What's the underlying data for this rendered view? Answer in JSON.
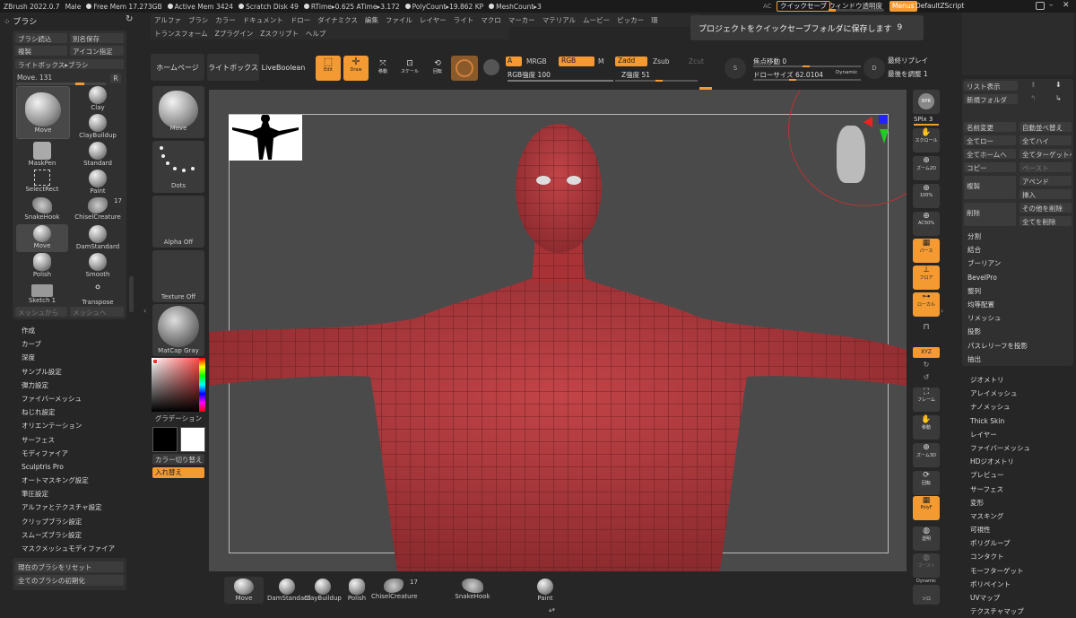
{
  "titlebar": {
    "app": "ZBrush 2022.0.7",
    "doc": "Male",
    "free_mem": "Free Mem 17.273GB",
    "active_mem": "Active Mem 3424",
    "scratch": "Scratch Disk 49",
    "rtime": "RTime▸0.625 ATime▸3.172",
    "polycount": "PolyCount▸19.862 KP",
    "meshcount": "MeshCount▸3",
    "ac": "AC",
    "quicksave": "クイックセーブ",
    "transparency": "ウィンドウ透明度",
    "menus": "Menus",
    "script": "DefaultZScript"
  },
  "menubar": {
    "row1": [
      "アルファ",
      "ブラシ",
      "カラー",
      "ドキュメント",
      "ドロー",
      "ダイナミクス",
      "編集",
      "ファイル",
      "レイヤー",
      "ライト",
      "マクロ",
      "マーカー",
      "マテリアル",
      "ムービー",
      "ピッカー",
      "環"
    ],
    "row2": [
      "トランスフォーム",
      "Zプラグイン",
      "Zスクリプト",
      "ヘルプ"
    ]
  },
  "notification": {
    "text": "プロジェクトをクイックセーブフォルダに保存します",
    "count": "9"
  },
  "brush_panel": {
    "title": "ブラシ",
    "load": "ブラシ読込",
    "save_as": "別名保存",
    "copy": "複製",
    "icon_set": "アイコン指定",
    "lightbox": "ライトボックス▸ブラシ",
    "current": "Move. 131",
    "r": "R",
    "brushes": [
      "Move",
      "Clay",
      "ClayBuildup",
      "MaskPen",
      "Standard",
      "SelectRect",
      "Paint",
      "SnakeHook",
      "ChiselCreature",
      "Move",
      "DamStandard",
      "Polish",
      "Smooth",
      "Sketch 1",
      "Transpose"
    ],
    "chisel_count": "17",
    "from_mesh": "メッシュから",
    "to_mesh": "メッシュへ",
    "menu": [
      "作成",
      "カーブ",
      "深度",
      "サンプル設定",
      "弾力設定",
      "ファイバーメッシュ",
      "ねじれ設定",
      "オリエンテーション",
      "サーフェス",
      "モディファイア",
      "Sculptris Pro",
      "オートマスキング設定",
      "筆圧設定",
      "アルファとテクスチャ設定",
      "クリップブラシ設定",
      "スムーズブラシ設定",
      "マスクメッシュモディファイア"
    ],
    "reset": "現在のブラシをリセット",
    "init_all": "全てのブラシの初期化"
  },
  "tray": {
    "move": "Move",
    "dots": "Dots",
    "alpha": "Alpha Off",
    "texture": "Texture Off",
    "matcap": "MatCap Gray",
    "gradient": "グラデーション",
    "swap_color": "カラー切り替え",
    "swap": "入れ替え"
  },
  "top_shelf": {
    "home": "ホームページ",
    "lightbox": "ライトボックス",
    "liveboolean": "LiveBoolean",
    "edit": "Edit",
    "draw": "Draw",
    "move": "移動",
    "scale": "スケール",
    "rotate": "回転",
    "a": "A",
    "mrgb": "MRGB",
    "rgb": "RGB",
    "m": "M",
    "rgb_strength": "RGB強度 100",
    "zadd": "Zadd",
    "zsub": "Zsub",
    "zcut": "Zcut",
    "z_strength": "Z強度 51",
    "focal_shift": "焦点移動 0",
    "draw_size": "ドローサイズ 62.0104",
    "dynamic": "Dynamic",
    "replay_last": "最終リプレイ",
    "adjust_last": "最後を調整 1"
  },
  "right_tools": {
    "bpr": "BPR",
    "spix": "SPix 3",
    "scroll": "スクロール",
    "zoom2d": "ズーム2D",
    "pct100": "100%",
    "ac50": "AC50%",
    "perspective": "パース",
    "floor": "フロア",
    "local": "ローカル",
    "xyz": "XYZ",
    "frame": "フレーム",
    "move": "移動",
    "zoom3d": "ズーム3D",
    "rotate": "回転",
    "polyf": "PolyF",
    "transp": "透明",
    "ghost": "ゴースト",
    "dynamic": "Dynamic",
    "solo": "ソロ"
  },
  "subtool": {
    "list_view": "リスト表示",
    "new_folder": "新規フォルダ",
    "rename": "名前変更",
    "auto_sort": "自動並べ替え",
    "all_low": "全てロー",
    "all_high": "全てハイ",
    "all_home": "全てホームへ",
    "all_target": "全てターゲットへ",
    "copy": "コピー",
    "paste": "ペースト",
    "duplicate": "複製",
    "append": "アペンド",
    "insert": "挿入",
    "delete": "削除",
    "del_other": "その他を削除",
    "del_all": "全てを削除",
    "menu1": [
      "分割",
      "結合",
      "ブーリアン",
      "BevelPro",
      "整列",
      "均等配置",
      "リメッシュ",
      "投影",
      "パスレリーフを投影",
      "抽出"
    ],
    "menu2": [
      "ジオメトリ",
      "アレイメッシュ",
      "ナノメッシュ",
      "Thick Skin",
      "レイヤー",
      "ファイバーメッシュ",
      "HDジオメトリ",
      "プレビュー",
      "サーフェス",
      "変形",
      "マスキング",
      "可視性",
      "ポリグループ",
      "コンタクト",
      "モーフターゲット",
      "ポリペイント",
      "UVマップ",
      "テクスチャマップ"
    ]
  },
  "bottom_shelf": [
    "Move",
    "DamStandard",
    "ClayBuildup",
    "Polish",
    "ChiselCreature",
    "SnakeHook",
    "Paint"
  ],
  "bottom_count": "17",
  "colors": {
    "accent": "#f39a32",
    "model": "#b8393d",
    "bg": "#262626",
    "canvas": "#4a4a4a"
  }
}
